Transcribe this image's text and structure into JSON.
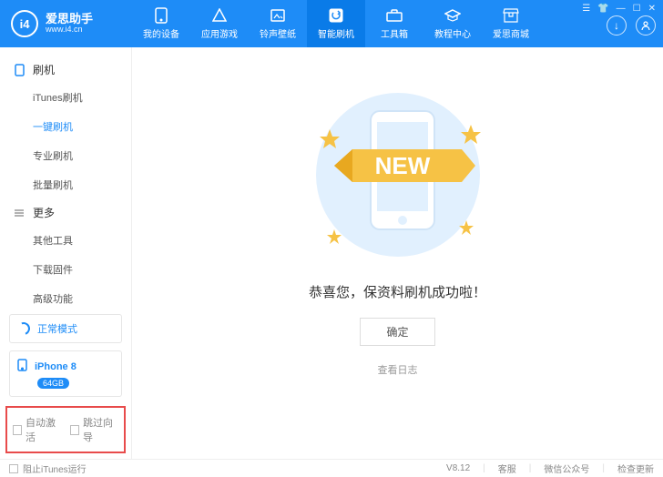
{
  "app": {
    "name": "爱思助手",
    "url": "www.i4.cn",
    "logo_text": "i4"
  },
  "header": {
    "tabs": [
      {
        "label": "我的设备"
      },
      {
        "label": "应用游戏"
      },
      {
        "label": "铃声壁纸"
      },
      {
        "label": "智能刷机",
        "active": true
      },
      {
        "label": "工具箱"
      },
      {
        "label": "教程中心"
      },
      {
        "label": "爱思商城"
      }
    ]
  },
  "sidebar": {
    "sections": [
      {
        "title": "刷机",
        "items": [
          "iTunes刷机",
          "一键刷机",
          "专业刷机",
          "批量刷机"
        ],
        "active_index": 1
      },
      {
        "title": "更多",
        "items": [
          "其他工具",
          "下载固件",
          "高级功能"
        ]
      }
    ],
    "mode": "正常模式",
    "device": {
      "name": "iPhone 8",
      "storage": "64GB"
    },
    "checks": {
      "auto_activate": "自动激活",
      "skip_guide": "跳过向导"
    }
  },
  "main": {
    "illus_badge": "NEW",
    "message": "恭喜您，保资料刷机成功啦！",
    "confirm": "确定",
    "view_log": "查看日志"
  },
  "footer": {
    "block_itunes": "阻止iTunes运行",
    "version": "V8.12",
    "links": [
      "客服",
      "微信公众号",
      "检查更新"
    ]
  }
}
